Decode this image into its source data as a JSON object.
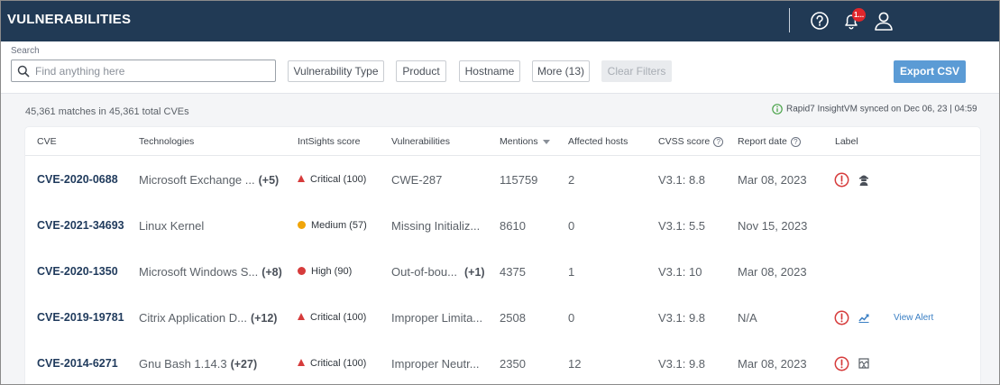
{
  "header": {
    "title": "VULNERABILITIES",
    "notification_count": "1..."
  },
  "filters": {
    "search_label": "Search",
    "search_placeholder": "Find anything here",
    "buttons": [
      {
        "label": "Vulnerability Type"
      },
      {
        "label": "Product"
      },
      {
        "label": "Hostname"
      },
      {
        "label": "More (13)"
      },
      {
        "label": "Clear Filters"
      }
    ],
    "export_label": "Export CSV"
  },
  "summary": {
    "matches": "45,361 matches in 45,361 total CVEs",
    "sync_status": "Rapid7 InsightVM synced on Dec 06, 23 | 04:59"
  },
  "table": {
    "columns": [
      "CVE",
      "Technologies",
      "IntSights score",
      "Vulnerabilities",
      "Mentions",
      "Affected hosts",
      "CVSS score",
      "Report date",
      "Label"
    ],
    "rows": [
      {
        "cve": "CVE-2020-0688",
        "tech": "Microsoft Exchange ...",
        "tech_more": "(+5)",
        "score": "Critical (100)",
        "severity": "critical",
        "vuln": "CWE-287",
        "vuln_more": "",
        "mentions": "115759",
        "hosts": "2",
        "cvss": "V3.1: 8.8",
        "date": "Mar 08, 2023",
        "labels": [
          "exclamation-icon",
          "hacker-icon"
        ],
        "alert_link": ""
      },
      {
        "cve": "CVE-2021-34693",
        "tech": "Linux Kernel",
        "tech_more": "",
        "score": "Medium (57)",
        "severity": "medium",
        "vuln": "Missing Initializ...",
        "vuln_more": "",
        "mentions": "8610",
        "hosts": "0",
        "cvss": "V3.1: 5.5",
        "date": "Nov 15, 2023",
        "labels": [],
        "alert_link": ""
      },
      {
        "cve": "CVE-2020-1350",
        "tech": "Microsoft Windows S...",
        "tech_more": "(+8)",
        "score": "High (90)",
        "severity": "high",
        "vuln": "Out-of-bou...",
        "vuln_more": "(+1)",
        "mentions": "4375",
        "hosts": "1",
        "cvss": "V3.1: 10",
        "date": "Mar 08, 2023",
        "labels": [],
        "alert_link": ""
      },
      {
        "cve": "CVE-2019-19781",
        "tech": "Citrix Application D...",
        "tech_more": "(+12)",
        "score": "Critical (100)",
        "severity": "critical",
        "vuln": "Improper Limita...",
        "vuln_more": "",
        "mentions": "2508",
        "hosts": "0",
        "cvss": "V3.1: 9.8",
        "date": "N/A",
        "labels": [
          "exclamation-icon",
          "trend-icon"
        ],
        "alert_link": "View Alert"
      },
      {
        "cve": "CVE-2014-6271",
        "tech": "Gnu Bash 1.14.3",
        "tech_more": "(+27)",
        "score": "Critical (100)",
        "severity": "critical",
        "vuln": "Improper Neutr...",
        "vuln_more": "",
        "mentions": "2350",
        "hosts": "12",
        "cvss": "V3.1: 9.8",
        "date": "Mar 08, 2023",
        "labels": [
          "exclamation-icon",
          "exploit-icon"
        ],
        "alert_link": ""
      }
    ]
  },
  "colors": {
    "header_bg": "#213a55",
    "critical": "#d63b3b",
    "high": "#d63b3b",
    "medium": "#f0a50a",
    "accent": "#5b9bd5"
  }
}
